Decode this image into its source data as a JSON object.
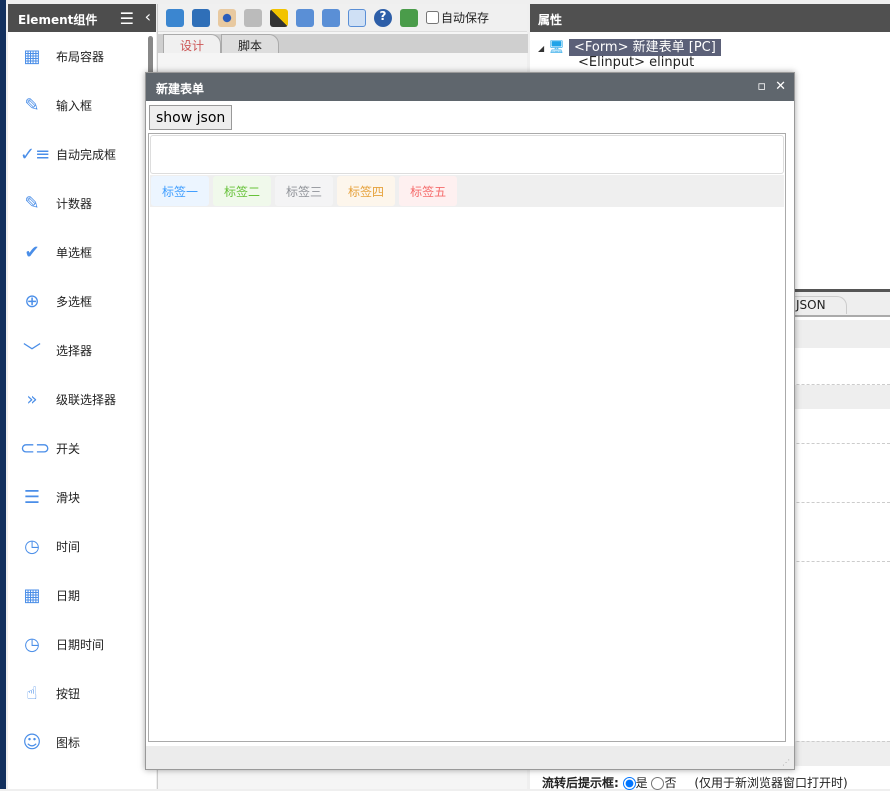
{
  "sidebar": {
    "title": "Element组件",
    "items": [
      {
        "label": "布局容器",
        "icon": "grid-icon"
      },
      {
        "label": "输入框",
        "icon": "pencil-icon"
      },
      {
        "label": "自动完成框",
        "icon": "check-list-icon"
      },
      {
        "label": "计数器",
        "icon": "edit-icon"
      },
      {
        "label": "单选框",
        "icon": "check-circle-icon"
      },
      {
        "label": "多选框",
        "icon": "plus-circle-icon"
      },
      {
        "label": "选择器",
        "icon": "chevron-down-icon"
      },
      {
        "label": "级联选择器",
        "icon": "double-chevron-icon"
      },
      {
        "label": "开关",
        "icon": "toggle-icon"
      },
      {
        "label": "滑块",
        "icon": "sliders-icon"
      },
      {
        "label": "时间",
        "icon": "clock-icon"
      },
      {
        "label": "日期",
        "icon": "calendar-icon"
      },
      {
        "label": "日期时间",
        "icon": "clock-icon"
      },
      {
        "label": "按钮",
        "icon": "pointer-icon"
      },
      {
        "label": "图标",
        "icon": "smile-icon"
      }
    ]
  },
  "toolbar": {
    "autosave_label": "自动保存",
    "autosave_checked": false
  },
  "editor_tabs": [
    {
      "label": "设计",
      "active": true
    },
    {
      "label": "脚本",
      "active": false
    }
  ],
  "properties": {
    "title": "属性",
    "tree": [
      {
        "label": "<Form> 新建表单 [PC]",
        "selected": true
      },
      {
        "label": "<Elinput> elinput"
      }
    ],
    "tab_json": "JSON",
    "flow_prompt_label": "流转后提示框:",
    "yes": "是",
    "no": "否",
    "note": "(仅用于新浏览器窗口打开时)",
    "flow_prompt_value": "是"
  },
  "dialog": {
    "title": "新建表单",
    "show_json": "show json",
    "tags": [
      {
        "label": "标签一",
        "color": "#409eff",
        "bg": "#ecf5ff"
      },
      {
        "label": "标签二",
        "color": "#67c23a",
        "bg": "#f0f9eb"
      },
      {
        "label": "标签三",
        "color": "#909399",
        "bg": "#f4f4f5"
      },
      {
        "label": "标签四",
        "color": "#e6a23c",
        "bg": "#fdf6ec"
      },
      {
        "label": "标签五",
        "color": "#f56c6c",
        "bg": "#fef0f0"
      }
    ]
  }
}
